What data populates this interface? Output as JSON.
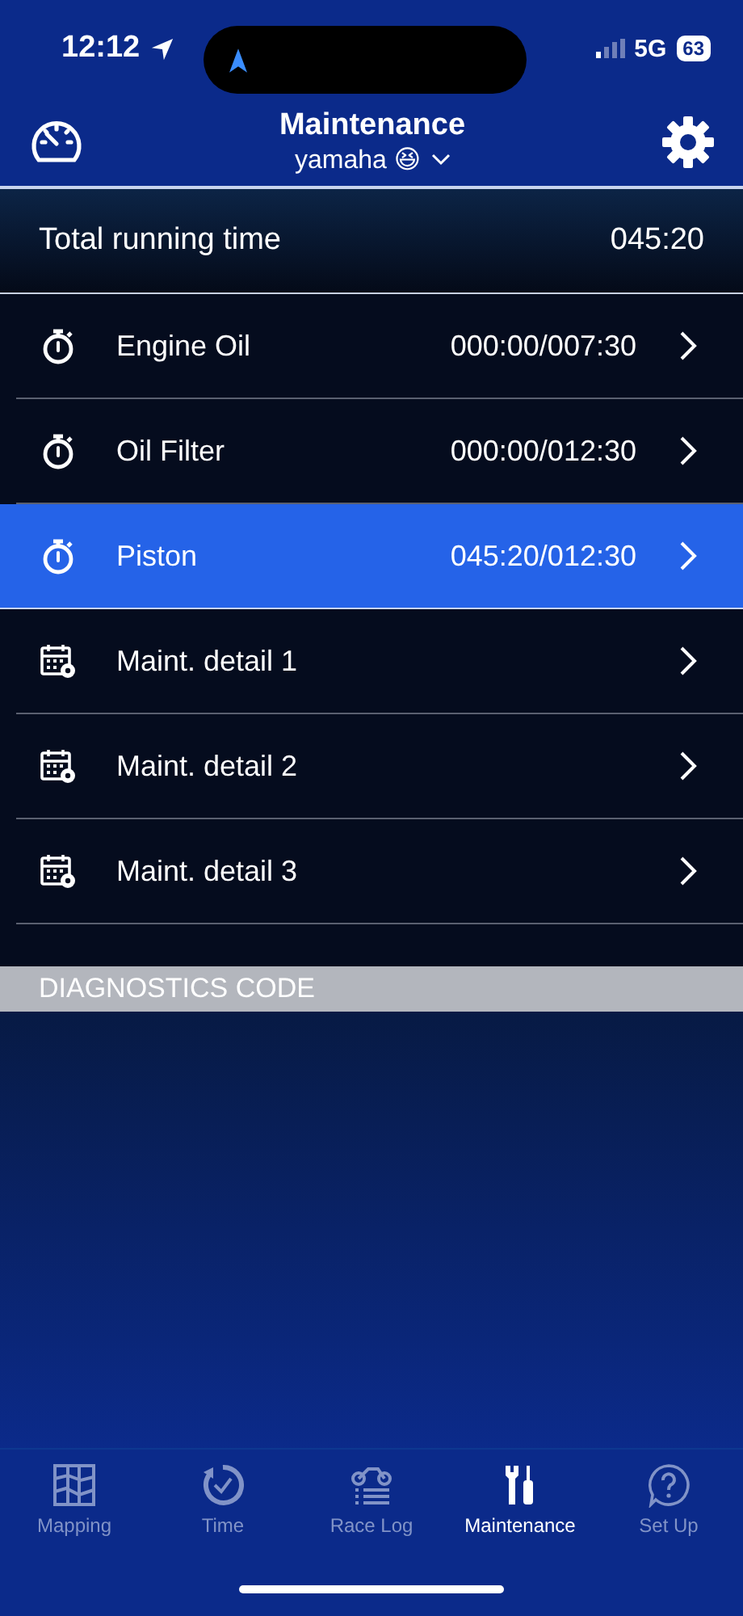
{
  "status_bar": {
    "time": "12:12",
    "network": "5G",
    "battery": "63"
  },
  "header": {
    "title": "Maintenance",
    "subtitle": "yamaha",
    "emoji": "😆"
  },
  "total": {
    "label": "Total running time",
    "value": "045:20"
  },
  "items": [
    {
      "kind": "timer",
      "label": "Engine Oil",
      "value": "000:00/007:30",
      "selected": false
    },
    {
      "kind": "timer",
      "label": "Oil Filter",
      "value": "000:00/012:30",
      "selected": false
    },
    {
      "kind": "timer",
      "label": "Piston",
      "value": "045:20/012:30",
      "selected": true
    },
    {
      "kind": "calendar",
      "label": "Maint. detail 1",
      "selected": false
    },
    {
      "kind": "calendar",
      "label": "Maint. detail 2",
      "selected": false
    },
    {
      "kind": "calendar",
      "label": "Maint. detail 3",
      "selected": false
    }
  ],
  "section": {
    "title": "DIAGNOSTICS CODE"
  },
  "tabs": [
    {
      "kind": "map",
      "label": "Mapping",
      "selected": false
    },
    {
      "kind": "time",
      "label": "Time",
      "selected": false
    },
    {
      "kind": "racelog",
      "label": "Race Log",
      "selected": false
    },
    {
      "kind": "maintenance",
      "label": "Maintenance",
      "selected": true
    },
    {
      "kind": "setup",
      "label": "Set Up",
      "selected": false
    }
  ]
}
